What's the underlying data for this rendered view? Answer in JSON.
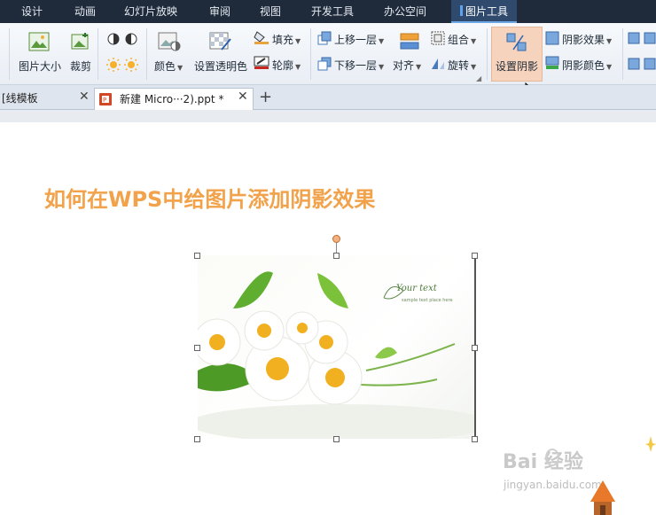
{
  "menu": {
    "items": [
      "设计",
      "动画",
      "幻灯片放映",
      "审阅",
      "视图",
      "开发工具",
      "办公空间"
    ],
    "active": "图片工具"
  },
  "ribbon": {
    "picture_size": "图片大小",
    "crop": "裁剪",
    "color": "颜色",
    "set_transparent": "设置透明色",
    "fill": "填充",
    "outline": "轮廓",
    "bring_forward": "上移一层",
    "send_backward": "下移一层",
    "align": "对齐",
    "group": "组合",
    "rotate": "旋转",
    "set_shadow": "设置阴影",
    "shadow_effect": "阴影效果",
    "shadow_color": "阴影颜色"
  },
  "tabs": [
    {
      "label": "[线模板"
    },
    {
      "label": "新建 Micro···2).ppt *"
    }
  ],
  "slide": {
    "title": "如何在WPS中给图片添加阴影效果",
    "photo_text_1": "Your text",
    "photo_text_2": "sample text place here"
  },
  "watermark": {
    "brand": "Bai 经验",
    "url": "jingyan.baidu.com"
  },
  "colors": {
    "menubar": "#1f2a3a",
    "title": "#f1a24a",
    "shadow_highlight": "#f6d3bd"
  }
}
